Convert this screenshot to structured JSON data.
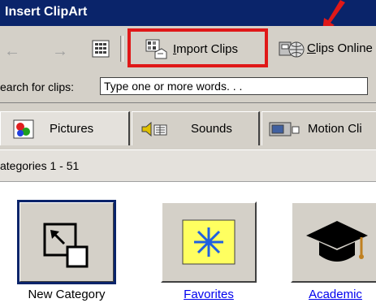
{
  "window": {
    "title": "Insert ClipArt"
  },
  "toolbar": {
    "import_clips_label": "Import Clips",
    "clips_online_label": "Clips Online",
    "icons": [
      "back-arrow-icon",
      "forward-arrow-icon",
      "grid-view-icon",
      "import-clips-icon",
      "clips-online-icon"
    ]
  },
  "search": {
    "label": "earch for clips:",
    "value": "Type one or more words. . ."
  },
  "tabs": [
    {
      "label": "Pictures",
      "icon": "pictures-icon",
      "active": true
    },
    {
      "label": "Sounds",
      "icon": "sounds-icon",
      "active": false
    },
    {
      "label": "Motion Cli",
      "icon": "motion-clips-icon",
      "active": false
    }
  ],
  "categories": {
    "count_label": "ategories 1 - 51",
    "items": [
      {
        "label": "New Category",
        "icon": "new-category-icon"
      },
      {
        "label": "Favorites",
        "icon": "favorites-star-icon"
      },
      {
        "label": "Academic",
        "icon": "graduation-cap-icon"
      }
    ]
  },
  "colors": {
    "title_bar": "#0a246a",
    "highlight_box": "#e01818",
    "window_face": "#d4d0c8",
    "link": "#0000ee"
  }
}
